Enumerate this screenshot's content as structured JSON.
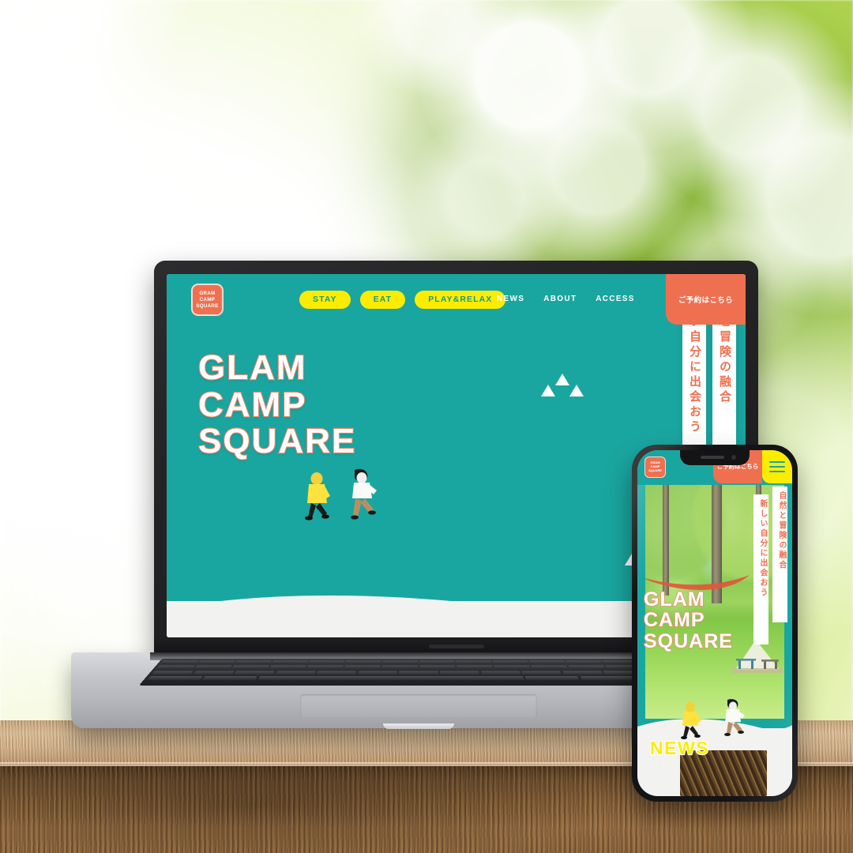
{
  "scene": {
    "description": "laptop-and-phone-mockup-on-wooden-table",
    "background": "green-bokeh-foliage"
  },
  "colors": {
    "teal": "#1aa6a0",
    "yellow": "#fced00",
    "coral": "#ef7050",
    "white": "#ffffff",
    "offwhite": "#f2f2f0",
    "wood_light": "#cfae85",
    "wood_dark": "#8a6238"
  },
  "site": {
    "logo": {
      "line1": "GRAM",
      "line2": "CAMP",
      "line3": "SQUARE"
    },
    "nav_pills": [
      {
        "label": "STAY"
      },
      {
        "label": "EAT"
      },
      {
        "label": "PLAY&RELAX"
      }
    ],
    "nav_links": [
      {
        "label": "NEWS"
      },
      {
        "label": "ABOUT"
      },
      {
        "label": "ACCESS"
      }
    ],
    "cta": {
      "label": "ご予約はこちら"
    },
    "hero": {
      "title_line1": "GLAM",
      "title_line2": "CAMP",
      "title_line3": "SQUARE",
      "vertical_text_right": "自然と冒険の融合",
      "vertical_text_left": "新しい自分に出会おう"
    }
  },
  "mobile": {
    "logo": {
      "line1": "GRAM",
      "line2": "CAMP",
      "line3": "SQUARE"
    },
    "cta": {
      "label": "ご予約はこちら"
    },
    "menu_icon": "hamburger-icon",
    "hero": {
      "title_line1": "GLAM",
      "title_line2": "CAMP",
      "title_line3": "SQUARE",
      "vertical_text_right": "自然と冒険の融合",
      "vertical_text_left": "新しい自分に出会おう"
    },
    "section": {
      "news_heading": "NEWS"
    }
  }
}
